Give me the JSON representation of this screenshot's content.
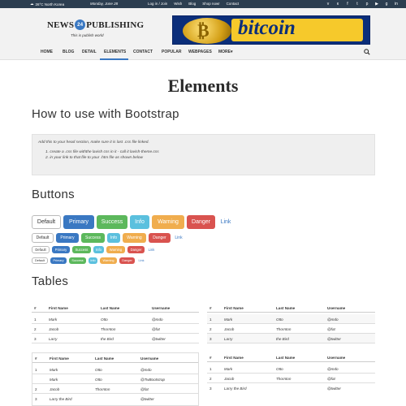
{
  "topbar": {
    "location": "26°C North Korea",
    "date": "Monday, June 28",
    "links": [
      "Log in / Join",
      "Wish",
      "Blog",
      "Shop now!",
      "Contact"
    ],
    "social_icons": [
      "vimeo-icon",
      "vk-icon",
      "facebook-icon",
      "twitter-icon",
      "pinterest-icon",
      "youtube-icon",
      "google-plus-icon",
      "linkedin-icon"
    ]
  },
  "logo": {
    "left": "NEWS",
    "badge": "24",
    "right": "PUBLISHING",
    "tagline": "This is publish world"
  },
  "banner": {
    "text": "bitcoin"
  },
  "nav": {
    "items": [
      "HOME",
      "BLOG",
      "DETAIL",
      "ELEMENTS",
      "CONTACT",
      "POPULAR",
      "WEBPAGES",
      "MORE"
    ],
    "active": "ELEMENTS"
  },
  "page": {
    "title": "Elements"
  },
  "bootstrap": {
    "heading": "How to use with Bootstrap",
    "intro": "Add this to your head section, make sure it is last .css file linked.",
    "steps": [
      "create a .css file withthe lavish css in it - call it lavish-theme.css",
      "in your link to that file to your .htm file as shown below"
    ]
  },
  "buttons": {
    "heading": "Buttons",
    "labels": [
      "Default",
      "Primary",
      "Success",
      "Info",
      "Warning",
      "Danger",
      "Link"
    ]
  },
  "tables": {
    "heading": "Tables",
    "headers": [
      "#",
      "First Name",
      "Last Name",
      "Username"
    ],
    "table1": [
      [
        "1",
        "Mark",
        "Otto",
        "@mdo"
      ],
      [
        "2",
        "Jacob",
        "Thornton",
        "@fat"
      ],
      [
        "3",
        "Larry",
        "the Bird",
        "@twitter"
      ]
    ],
    "table2": [
      [
        "1",
        "Mark",
        "Otto",
        "@mdo"
      ],
      [
        "2",
        "Jacob",
        "Thornton",
        "@fat"
      ],
      [
        "3",
        "Larry",
        "the Bird",
        "@twitter"
      ]
    ],
    "table3": [
      [
        "1",
        "Mark",
        "Otto",
        "@mdo"
      ],
      [
        "",
        "Mark",
        "Otto",
        "@TwBootstrap"
      ],
      [
        "2",
        "Jacob",
        "Thornton",
        "@fat"
      ],
      [
        "3",
        "Larry the Bird",
        "",
        "@twitter"
      ]
    ],
    "table4": [
      [
        "1",
        "Mark",
        "Otto",
        "@mdo"
      ],
      [
        "2",
        "Jacob",
        "Thornton",
        "@fat"
      ],
      [
        "3",
        "Larry the Bird",
        "",
        "@twitter"
      ]
    ]
  }
}
